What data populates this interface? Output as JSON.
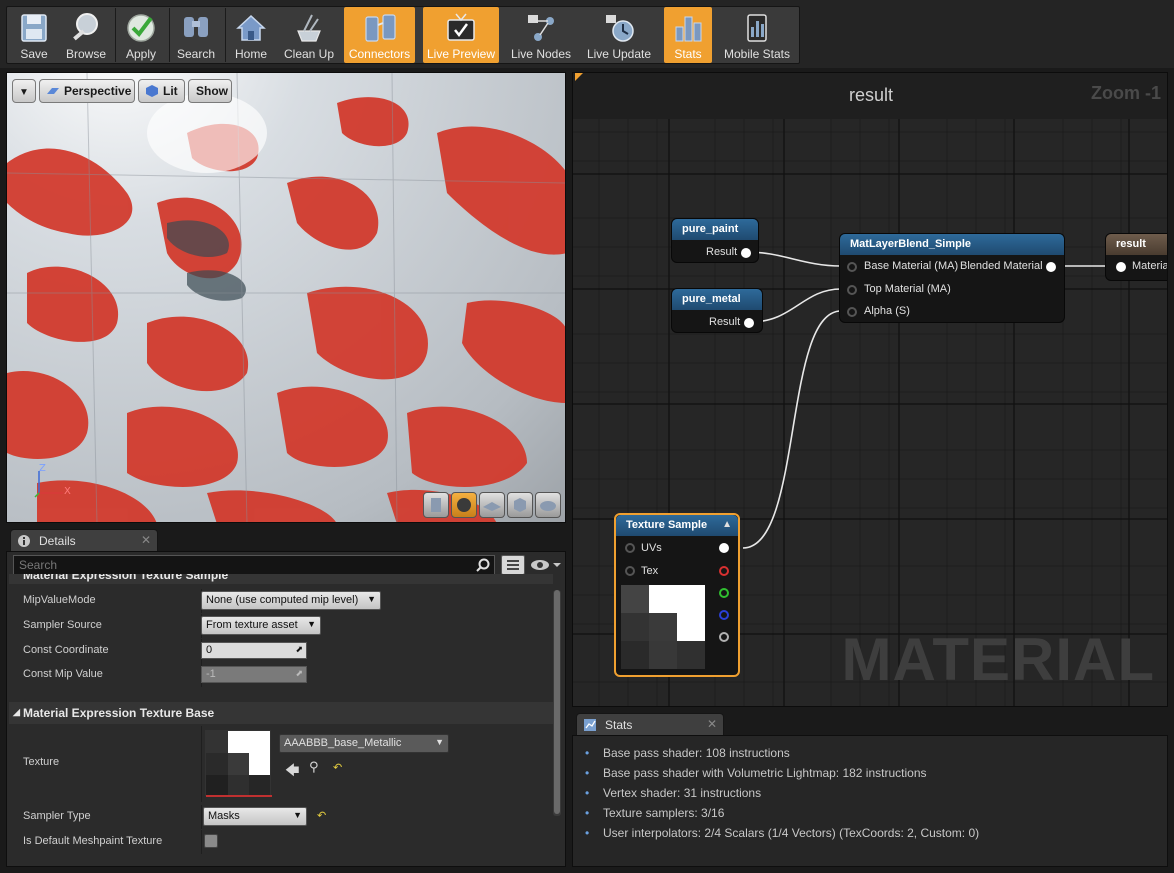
{
  "toolbar": {
    "buttons": [
      {
        "label": "Save",
        "icon": "save-icon",
        "active": false
      },
      {
        "label": "Browse",
        "icon": "browse-icon",
        "active": false
      },
      {
        "label": "Apply",
        "icon": "apply-icon",
        "active": false
      },
      {
        "label": "Search",
        "icon": "search-icon",
        "active": false
      },
      {
        "label": "Home",
        "icon": "home-icon",
        "active": false
      },
      {
        "label": "Clean Up",
        "icon": "clean-up-icon",
        "active": false
      },
      {
        "label": "Connectors",
        "icon": "connectors-icon",
        "active": true
      },
      {
        "label": "Live Preview",
        "icon": "live-preview-icon",
        "active": true
      },
      {
        "label": "Live Nodes",
        "icon": "live-nodes-icon",
        "active": false
      },
      {
        "label": "Live Update",
        "icon": "live-update-icon",
        "active": false
      },
      {
        "label": "Stats",
        "icon": "stats-icon",
        "active": true
      },
      {
        "label": "Mobile Stats",
        "icon": "mobile-stats-icon",
        "active": false
      }
    ]
  },
  "viewport": {
    "perspective_label": "Perspective",
    "lit_label": "Lit",
    "show_label": "Show",
    "axis_z": "Z",
    "axis_x": "X"
  },
  "details": {
    "tab_label": "Details",
    "search_placeholder": "Search",
    "section_texture_sample": "Material Expression Texture Sample",
    "mip_value_mode": {
      "label": "MipValueMode",
      "value": "None (use computed mip level)"
    },
    "sampler_source": {
      "label": "Sampler Source",
      "value": "From texture asset"
    },
    "const_coordinate": {
      "label": "Const Coordinate",
      "value": "0"
    },
    "const_mip_value": {
      "label": "Const Mip Value",
      "value": "-1"
    },
    "section_texture_base": "Material Expression Texture Base",
    "texture": {
      "label": "Texture",
      "value": "AAABBB_base_Metallic"
    },
    "sampler_type": {
      "label": "Sampler Type",
      "value": "Masks"
    },
    "is_default_meshpaint": {
      "label": "Is Default Meshpaint Texture",
      "checked": false
    }
  },
  "graph": {
    "title": "result",
    "zoom": "Zoom -1",
    "watermark": "MATERIAL",
    "nodes": {
      "pure_paint": {
        "title": "pure_paint",
        "output": "Result"
      },
      "pure_metal": {
        "title": "pure_metal",
        "output": "Result"
      },
      "blend": {
        "title": "MatLayerBlend_Simple",
        "in1": "Base Material (MA)",
        "out1": "Blended Material",
        "in2": "Top Material (MA)",
        "in3": "Alpha (S)"
      },
      "result": {
        "title": "result",
        "in1": "Material"
      },
      "texture_sample": {
        "title": "Texture Sample",
        "in1": "UVs",
        "in2": "Tex"
      }
    }
  },
  "stats": {
    "tab_label": "Stats",
    "lines": [
      "Base pass shader: 108 instructions",
      "Base pass shader with Volumetric Lightmap: 182 instructions",
      "Vertex shader: 31 instructions",
      "Texture samplers: 3/16",
      "User interpolators: 2/4 Scalars (1/4 Vectors) (TexCoords: 2, Custom: 0)"
    ]
  },
  "colors": {
    "accent_orange": "#f0a030",
    "node_blue_header": "#2a5a8a",
    "node_result_header": "#6b5a4a"
  }
}
